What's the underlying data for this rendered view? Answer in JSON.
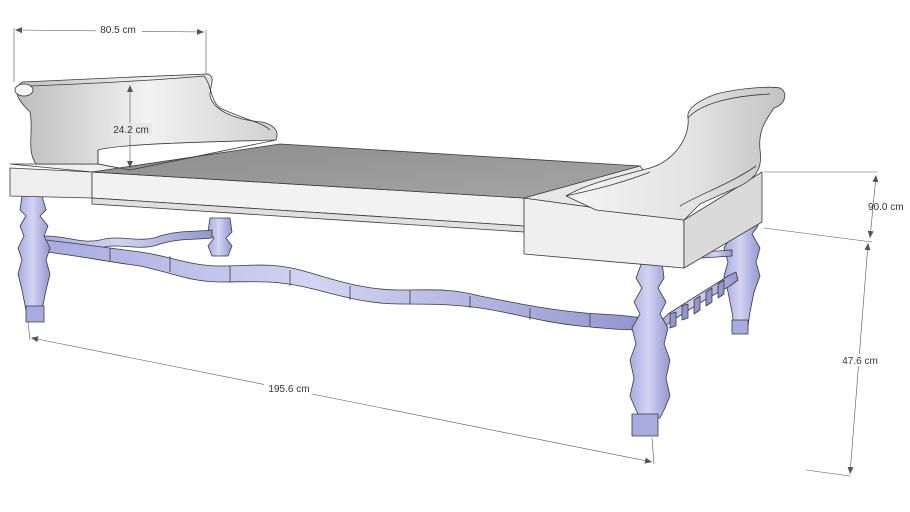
{
  "model": {
    "dimensions": {
      "armrest_width": "80.5 cm",
      "armrest_height": "24.2 cm",
      "depth": "90.0 cm",
      "length": "195.6 cm",
      "height": "47.6 cm"
    },
    "colors": {
      "frame": "#ececec",
      "frame_shade": "#dadada",
      "top": "#999999",
      "top_dark": "#8a8a8a",
      "turned_parts": "#b9bce6",
      "turned_parts_shade": "#9296cf",
      "edge": "#3a3a3a",
      "dimension": "#555555"
    }
  }
}
